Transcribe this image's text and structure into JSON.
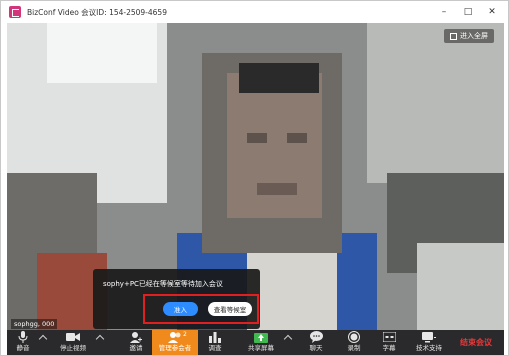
{
  "window": {
    "title": "BizConf Video 会议ID: 154-2509-4659",
    "minimize": "–",
    "maximize": "□",
    "close": "✕"
  },
  "video": {
    "fullscreen_label": "进入全屏",
    "participant_name": "sophgg, 000"
  },
  "notification": {
    "message": "sophy+PC已经在等候室等待加入会议",
    "admit_label": "准入",
    "view_waiting_label": "查看等候室"
  },
  "toolbar": {
    "items": [
      {
        "label": "静音",
        "icon": "microphone-icon"
      },
      {
        "label": "停止视频",
        "icon": "video-camera-icon"
      },
      {
        "label": "邀请",
        "icon": "invite-icon"
      },
      {
        "label": "管理参会者",
        "icon": "participants-icon",
        "badge": "2"
      },
      {
        "label": "调查",
        "icon": "poll-icon"
      },
      {
        "label": "共享屏幕",
        "icon": "share-screen-icon"
      },
      {
        "label": "聊天",
        "icon": "chat-icon"
      },
      {
        "label": "录制",
        "icon": "record-icon"
      },
      {
        "label": "字幕",
        "icon": "caption-icon"
      },
      {
        "label": "技术支持",
        "icon": "support-icon"
      }
    ],
    "end_label": "结束会议"
  },
  "colors": {
    "accent_orange": "#f08a1c",
    "admit_blue": "#2d8cff",
    "highlight_red": "#e02020",
    "end_red": "#e5393b",
    "toolbar_bg": "#2a2a2c"
  }
}
